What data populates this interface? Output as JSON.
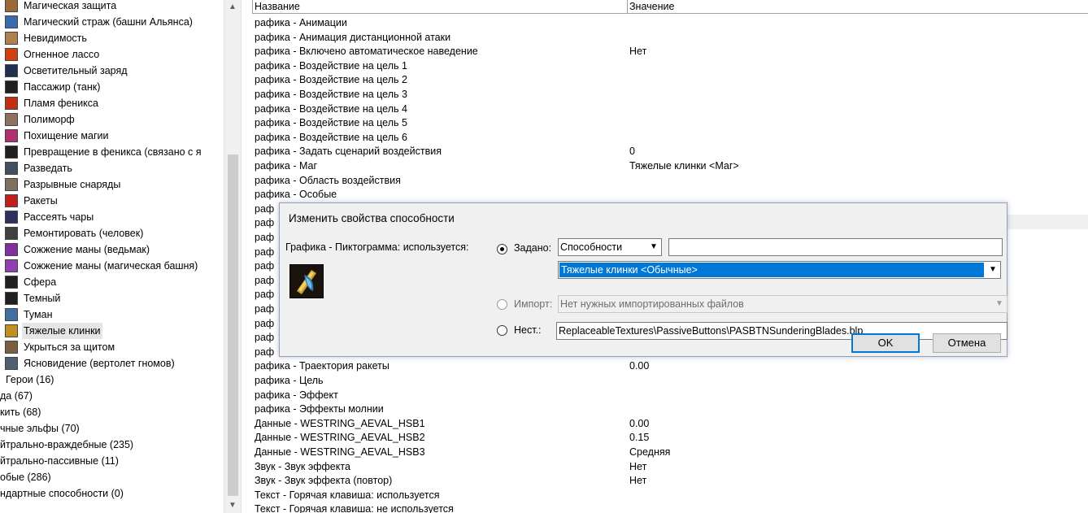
{
  "tree": {
    "items": [
      {
        "label": "Магическая защита",
        "icon_color": "#9a6a3a"
      },
      {
        "label": "Магический страж (башни Альянса)",
        "icon_color": "#3a6ab0"
      },
      {
        "label": "Невидимость",
        "icon_color": "#b08050"
      },
      {
        "label": "Огненное лассо",
        "icon_color": "#d04010"
      },
      {
        "label": "Осветительный заряд",
        "icon_color": "#203050"
      },
      {
        "label": "Пассажир (танк)",
        "icon_color": "#202020"
      },
      {
        "label": "Пламя феникса",
        "icon_color": "#c03010"
      },
      {
        "label": "Полиморф",
        "icon_color": "#907060"
      },
      {
        "label": "Похищение магии",
        "icon_color": "#b03070"
      },
      {
        "label": "Превращение в феникса (связано с я",
        "icon_color": "#202020"
      },
      {
        "label": "Разведать",
        "icon_color": "#405060"
      },
      {
        "label": "Разрывные снаряды",
        "icon_color": "#807060"
      },
      {
        "label": "Ракеты",
        "icon_color": "#c02020"
      },
      {
        "label": "Рассеять чары",
        "icon_color": "#303060"
      },
      {
        "label": "Ремонтировать (человек)",
        "icon_color": "#404040"
      },
      {
        "label": "Сожжение маны (ведьмак)",
        "icon_color": "#8030a0"
      },
      {
        "label": "Сожжение маны (магическая башня)",
        "icon_color": "#9040b0"
      },
      {
        "label": "Сфера",
        "icon_color": "#202020"
      },
      {
        "label": "Темный",
        "icon_color": "#202020"
      },
      {
        "label": "Туман",
        "icon_color": "#4070a0"
      },
      {
        "label": "Тяжелые клинки",
        "icon_color": "#c09020",
        "selected": true
      },
      {
        "label": "Укрыться за щитом",
        "icon_color": "#7a6040"
      },
      {
        "label": "Ясновидение (вертолет гномов)",
        "icon_color": "#506070"
      }
    ],
    "categories": [
      {
        "label": "Герои (16)"
      },
      {
        "label": "да (67)"
      },
      {
        "label": "кить (68)"
      },
      {
        "label": "чные эльфы (70)"
      },
      {
        "label": "йтрально-враждебные (235)"
      },
      {
        "label": "йтрально-пассивные (11)"
      },
      {
        "label": "обые (286)"
      },
      {
        "label": "ндартные способности (0)"
      }
    ]
  },
  "grid": {
    "header": {
      "name": "Название",
      "value": "Значение"
    },
    "rows": [
      {
        "name": "рафика - Анимации",
        "value": ""
      },
      {
        "name": "рафика - Анимация дистанционной атаки",
        "value": ""
      },
      {
        "name": "рафика - Включено автоматическое наведение",
        "value": "Нет"
      },
      {
        "name": "рафика - Воздействие на цель 1",
        "value": ""
      },
      {
        "name": "рафика - Воздействие на цель 2",
        "value": ""
      },
      {
        "name": "рафика - Воздействие на цель 3",
        "value": ""
      },
      {
        "name": "рафика - Воздействие на цель 4",
        "value": ""
      },
      {
        "name": "рафика - Воздействие на цель 5",
        "value": ""
      },
      {
        "name": "рафика - Воздействие на цель 6",
        "value": ""
      },
      {
        "name": "рафика - Задать сценарий воздействия",
        "value": "0"
      },
      {
        "name": "рафика - Маг",
        "value": "Тяжелые клинки <Маг>"
      },
      {
        "name": "рафика - Область воздействия",
        "value": ""
      },
      {
        "name": "рафика - Особые",
        "value": ""
      },
      {
        "name": "раф",
        "value": ""
      },
      {
        "name": "раф",
        "value": ""
      },
      {
        "name": "раф",
        "value": ""
      },
      {
        "name": "раф",
        "value": ""
      },
      {
        "name": "раф",
        "value": ""
      },
      {
        "name": "раф",
        "value": ""
      },
      {
        "name": "раф",
        "value": ""
      },
      {
        "name": "раф",
        "value": ""
      },
      {
        "name": "раф",
        "value": ""
      },
      {
        "name": "раф",
        "value": ""
      },
      {
        "name": "раф",
        "value": ""
      },
      {
        "name": "рафика - Траектория ракеты",
        "value": "0.00"
      },
      {
        "name": "рафика - Цель",
        "value": ""
      },
      {
        "name": "рафика - Эффект",
        "value": ""
      },
      {
        "name": "рафика - Эффекты молнии",
        "value": ""
      },
      {
        "name": "Данные - WESTRING_AEVAL_HSB1",
        "value": "0.00"
      },
      {
        "name": "Данные - WESTRING_AEVAL_HSB2",
        "value": "0.15"
      },
      {
        "name": "Данные - WESTRING_AEVAL_HSB3",
        "value": "Средняя"
      },
      {
        "name": "Звук - Звук эффекта",
        "value": "Нет"
      },
      {
        "name": "Звук - Звук эффекта (повтор)",
        "value": "Нет"
      },
      {
        "name": "Текст - Горячая клавиша: используется",
        "value": ""
      },
      {
        "name": "Текст - Горячая клавиша: не используется",
        "value": ""
      }
    ]
  },
  "dialog": {
    "title": "Изменить свойства способности",
    "field_label": "Графика - Пиктограмма: используется:",
    "option_set_label": "Задано:",
    "option_set_category": "Способности",
    "option_set_text": "",
    "option_set_item": "Тяжелые клинки <Обычные>",
    "option_import_label": "Импорт:",
    "option_import_value": "Нет нужных импортированных файлов",
    "option_custom_label": "Нест.:",
    "option_custom_value": "ReplaceableTextures\\PassiveButtons\\PASBTNSunderingBlades.blp",
    "ok_label": "OK",
    "cancel_label": "Отмена"
  },
  "colors": {
    "selection_blue": "#0078d7",
    "dialog_bg": "#f0f0f0",
    "tree_selected_bg": "#e6e6e6"
  }
}
